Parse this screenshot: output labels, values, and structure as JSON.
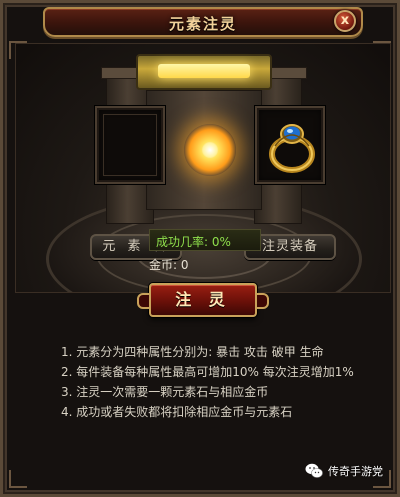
{
  "window": {
    "title": "元素注灵",
    "close_label": "x"
  },
  "slots": {
    "left": {
      "label": "元 素 石",
      "icon": "empty-slot"
    },
    "right": {
      "label": "注灵装备",
      "icon": "gold-ring-icon"
    }
  },
  "success": {
    "label": "成功几率: 0%",
    "rate": 0
  },
  "coins": {
    "label": "金币:",
    "value": "0"
  },
  "action": {
    "label": "注 灵"
  },
  "instructions": [
    "1. 元素分为四种属性分别为: 暴击 攻击 破甲 生命",
    "2. 每件装备每种属性最高可增加10% 每次注灵增加1%",
    "3. 注灵一次需要一颗元素石与相应金币",
    "4. 成功或者失败都将扣除相应金币与元素石"
  ],
  "watermark": {
    "text": "传奇手游党",
    "icon": "wechat-icon"
  },
  "colors": {
    "title_text": "#f2d29a",
    "success_text": "#8fe04c",
    "button_red": "#9a1f12",
    "frame_gold": "#c9a25a"
  }
}
